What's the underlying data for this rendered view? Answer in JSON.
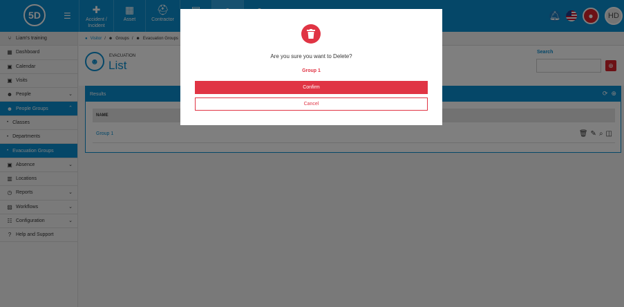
{
  "topbar": {
    "logo": "5D",
    "nav": [
      {
        "label": "Accident / Incident",
        "icon": "first-aid-icon"
      },
      {
        "label": "Asset",
        "icon": "boxes-icon"
      },
      {
        "label": "Contractor",
        "icon": "hardhat-icon"
      },
      {
        "label": "",
        "icon": "document-icon"
      },
      {
        "label": "",
        "icon": "person-icon"
      },
      {
        "label": "",
        "icon": "helmet-icon"
      }
    ],
    "avatar": "HD"
  },
  "sidebar": {
    "items": [
      {
        "label": "Liam's training",
        "icon": "branch-icon"
      },
      {
        "label": "Dashboard",
        "icon": "dashboard-icon"
      },
      {
        "label": "Calendar",
        "icon": "calendar-icon"
      },
      {
        "label": "Visits",
        "icon": "calendar-check-icon"
      },
      {
        "label": "People",
        "icon": "people-icon"
      },
      {
        "label": "People Groups",
        "icon": "group-icon"
      },
      {
        "label": "Classes",
        "icon": "dot-icon"
      },
      {
        "label": "Departments",
        "icon": "dot-icon"
      },
      {
        "label": "Evacuation Groups",
        "icon": "dot-icon"
      },
      {
        "label": "Absence",
        "icon": "calendar-x-icon"
      },
      {
        "label": "Locations",
        "icon": "building-icon"
      },
      {
        "label": "Reports",
        "icon": "clock-icon"
      },
      {
        "label": "Workflows",
        "icon": "image-icon"
      },
      {
        "label": "Configuration",
        "icon": "sliders-icon"
      },
      {
        "label": "Help and Support",
        "icon": "help-icon"
      }
    ]
  },
  "breadcrumb": {
    "visitor": "Visitor",
    "sep": "/",
    "groups": "Groups",
    "evac": "Evacuation Groups"
  },
  "page": {
    "subtitle": "EVACUATION",
    "title": "List",
    "search_label": "Search",
    "search_placeholder": ""
  },
  "results": {
    "title": "Results",
    "column": "NAME",
    "rows": [
      {
        "name": "Group 1"
      }
    ]
  },
  "modal": {
    "message": "Are you sure you want to Delete?",
    "item": "Group 1",
    "confirm": "Confirm",
    "cancel": "Cancel"
  },
  "colors": {
    "primary": "#0a8fd1",
    "danger": "#e03444"
  }
}
